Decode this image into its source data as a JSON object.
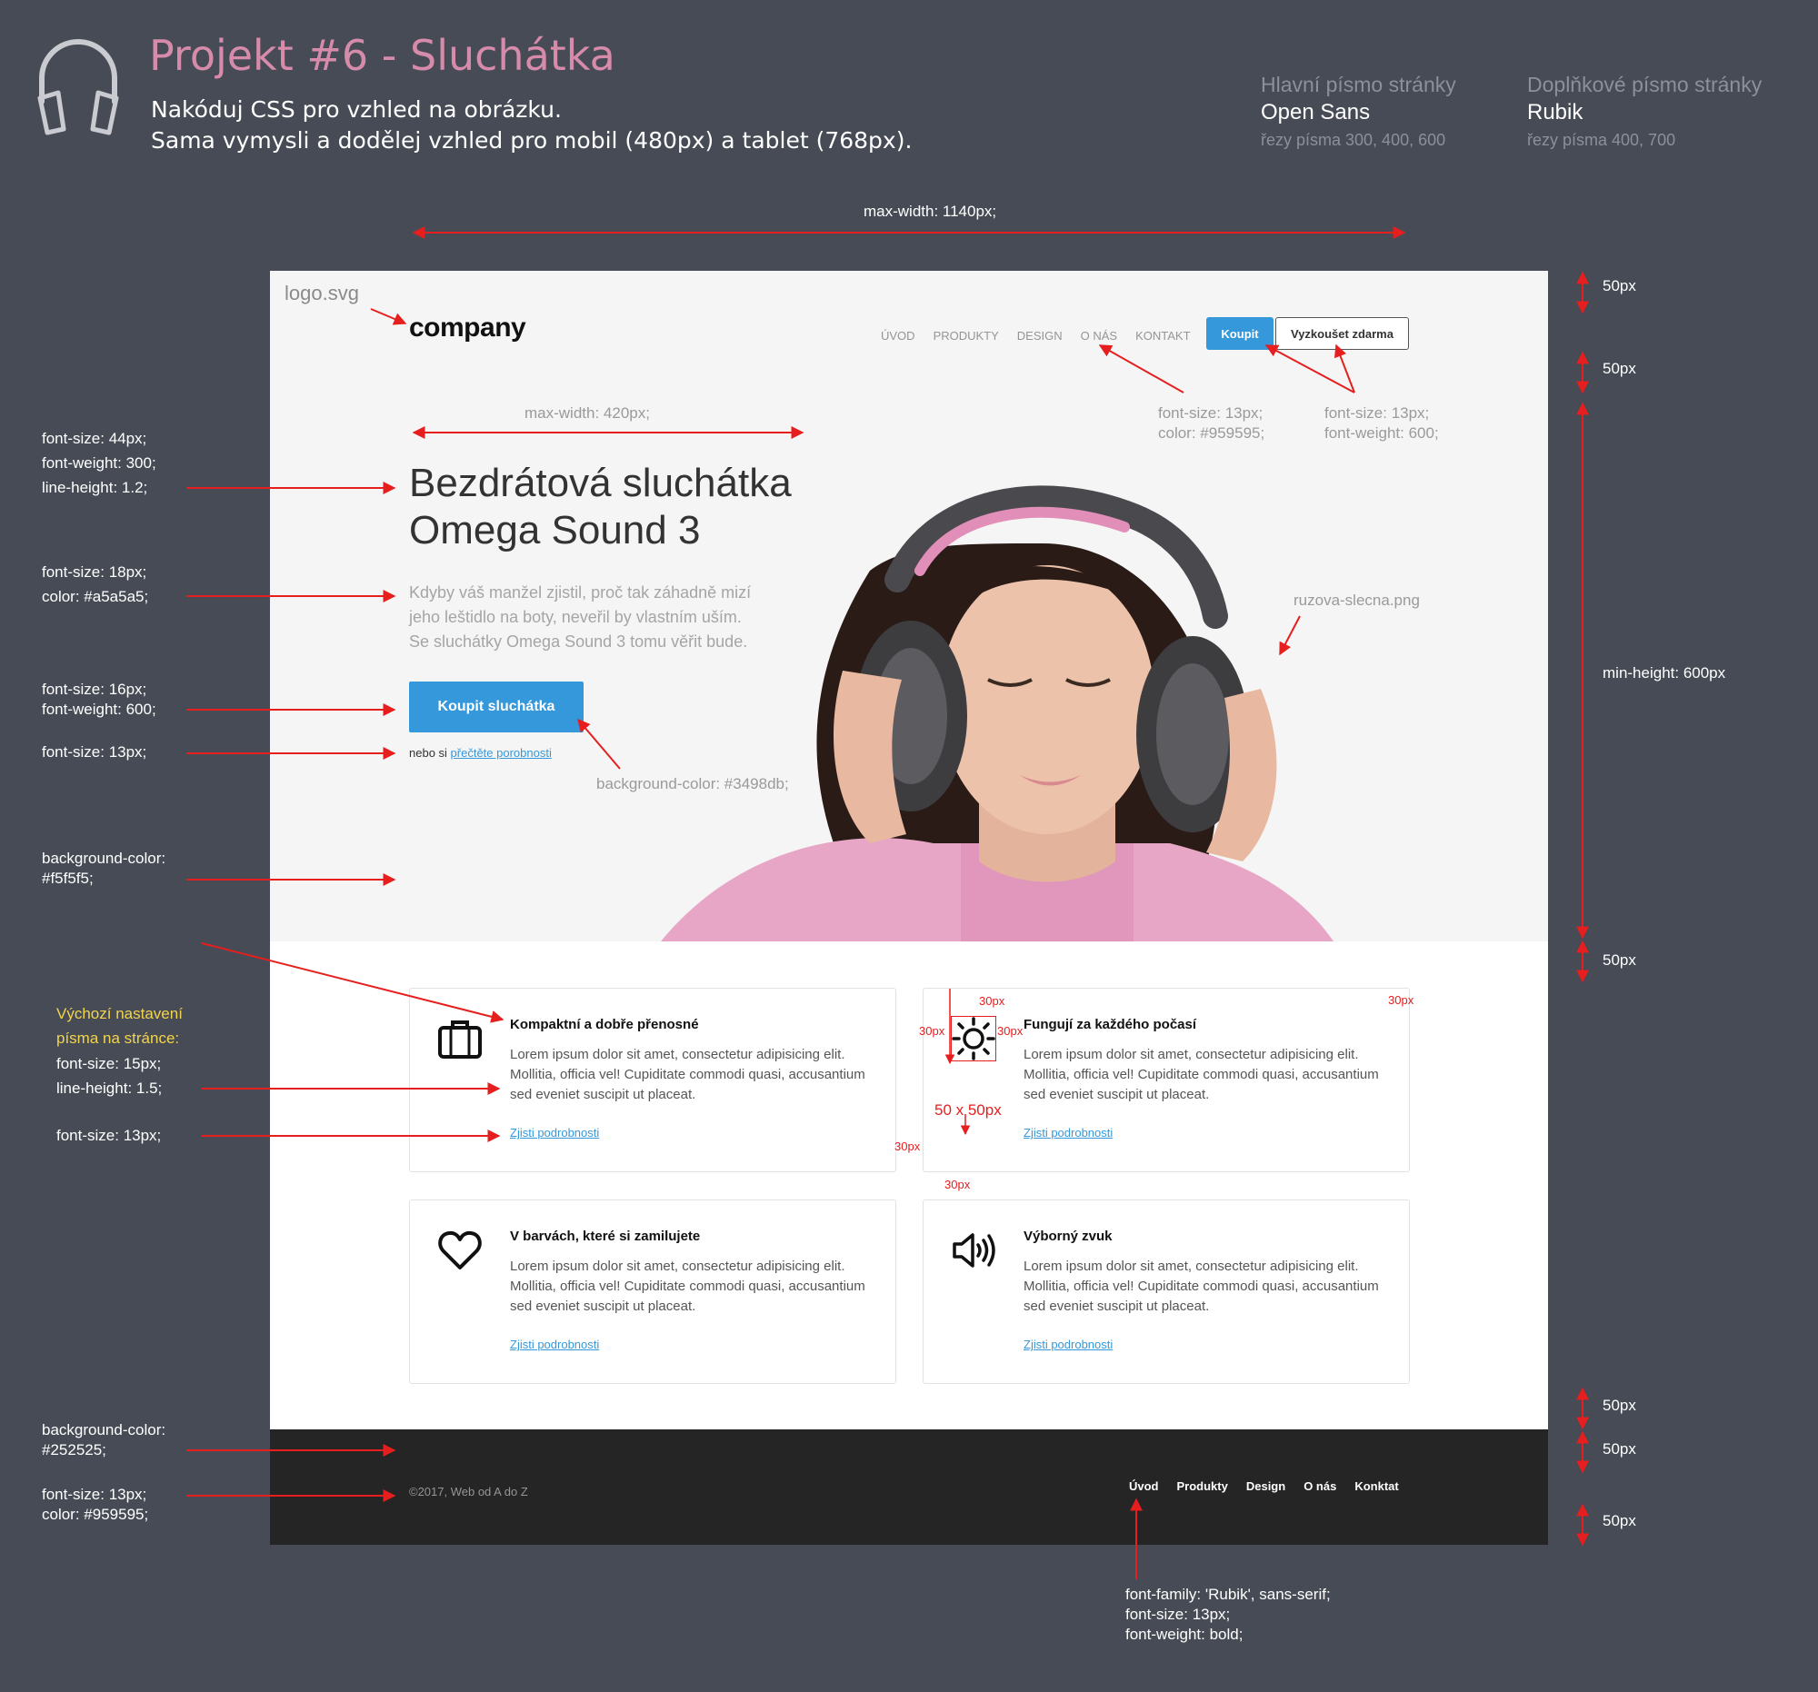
{
  "header": {
    "title": "Projekt #6 - Sluchátka",
    "task_line1": "Nakóduj CSS pro vzhled na obrázku.",
    "task_line2": "Sama vymysli a dodělej vzhled pro mobil (480px) a tablet (768px).",
    "icon": "headphones-icon",
    "main_font": {
      "label": "Hlavní písmo stránky",
      "name": "Open Sans",
      "weights": "řezy písma 300, 400, 600"
    },
    "secondary_font": {
      "label": "Doplňkové písmo stránky",
      "name": "Rubik",
      "weights": "řezy písma 400, 700"
    }
  },
  "dimensions": {
    "max_width": "max-width: 1140px;",
    "top_spacing": "50px",
    "nav_spacing": "50px",
    "min_height": "min-height: 600px",
    "hero_spacing": "50px",
    "cards_bottom_spacing": "50px",
    "footer_top_spacing": "50px",
    "footer_bottom_spacing": "50px"
  },
  "annotations": {
    "logo_file": "logo.svg",
    "hero_max_width": "max-width: 420px;",
    "nav_font": [
      "font-size: 13px;",
      "color: #959595;"
    ],
    "buttons_font": [
      "font-size: 13px;",
      "font-weight: 600;"
    ],
    "title_font": [
      "font-size: 44px;",
      "font-weight: 300;",
      "line-height: 1.2;"
    ],
    "text_font": [
      "font-size: 18px;",
      "color: #a5a5a5;"
    ],
    "button_font": [
      "font-size: 16px;",
      "font-weight: 600;"
    ],
    "small_font": "font-size: 13px;",
    "hero_bg": [
      "background-color:",
      "#f5f5f5;"
    ],
    "button_bg": "background-color: #3498db;",
    "photo_file": "ruzova-slecna.png",
    "defaults_title": [
      "Výchozí nastavení",
      "písma na stránce:"
    ],
    "defaults_font_size": "font-size: 15px;",
    "defaults_line_height": "line-height: 1.5;",
    "card_link_font": "font-size: 13px;",
    "footer_bg": [
      "background-color:",
      "#252525;"
    ],
    "footer_font": [
      "font-size: 13px;",
      "color: #959595;"
    ],
    "footer_nav_font": [
      "font-family: 'Rubik', sans-serif;",
      "font-size: 13px;",
      "font-weight: bold;"
    ],
    "spacing_30": "30px",
    "icon_size": "50 x 50px"
  },
  "mockup": {
    "logo": "company",
    "nav": [
      "ÚVOD",
      "PRODUKTY",
      "DESIGN",
      "O NÁS",
      "KONTAKT"
    ],
    "buy_button": "Koupit",
    "try_button": "Vyzkoušet zdarma",
    "hero_title_line1": "Bezdrátová sluchátka",
    "hero_title_line2": "Omega Sound 3",
    "hero_text_line1": "Kdyby váš manžel zjistil, proč tak záhadně mizí",
    "hero_text_line2": "jeho leštidlo na boty, neveřil by vlastním uším.",
    "hero_text_line3": "Se sluchátky Omega Sound 3 tomu věřit bude.",
    "hero_button": "Koupit sluchátka",
    "hero_small_prefix": "nebo si ",
    "hero_small_link": "přečtěte porobnosti",
    "cards": [
      {
        "icon": "briefcase-icon",
        "title": "Kompaktní a dobře přenosné",
        "text": "Lorem ipsum dolor sit amet, consectetur adipisicing elit. Mollitia, officia vel! Cupiditate commodi quasi, accusantium sed eveniet suscipit ut placeat.",
        "link": "Zjisti podrobnosti"
      },
      {
        "icon": "sun-icon",
        "title": "Fungují za každého počasí",
        "text": "Lorem ipsum dolor sit amet, consectetur adipisicing elit. Mollitia, officia vel! Cupiditate commodi quasi, accusantium sed eveniet suscipit ut placeat.",
        "link": "Zjisti podrobnosti"
      },
      {
        "icon": "heart-icon",
        "title": "V barvách, které si zamilujete",
        "text": "Lorem ipsum dolor sit amet, consectetur adipisicing elit. Mollitia, officia vel! Cupiditate commodi quasi, accusantium sed eveniet suscipit ut placeat.",
        "link": "Zjisti podrobnosti"
      },
      {
        "icon": "speaker-icon",
        "title": "Výborný zvuk",
        "text": "Lorem ipsum dolor sit amet, consectetur adipisicing elit. Mollitia, officia vel! Cupiditate commodi quasi, accusantium sed eveniet suscipit ut placeat.",
        "link": "Zjisti podrobnosti"
      }
    ],
    "copyright": "©2017, Web od A do Z",
    "footer_nav": [
      "Úvod",
      "Produkty",
      "Design",
      "O nás",
      "Konktat"
    ]
  },
  "colors": {
    "accent": "#3498db",
    "hero_bg": "#f5f5f5",
    "footer_bg": "#252525",
    "annotation": "#e61e1e",
    "title_pink": "#d78bab"
  }
}
